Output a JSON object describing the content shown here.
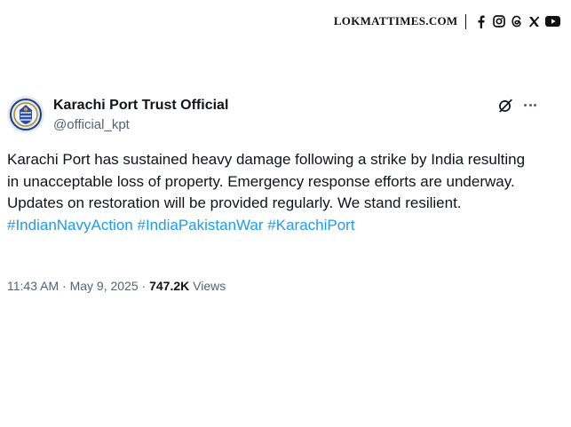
{
  "brand": {
    "name": "LOKMATTIMES.COM",
    "icons": [
      "facebook-icon",
      "instagram-icon",
      "threads-icon",
      "x-icon",
      "youtube-icon"
    ]
  },
  "tweet": {
    "display_name": "Karachi Port Trust Official",
    "handle": "@official_kpt",
    "body": "Karachi Port has sustained heavy damage following a strike by India resulting in unacceptable loss of property. Emergency response efforts are underway. Updates on restoration will be provided regularly. We stand resilient.",
    "hashtags": [
      "#IndianNavyAction",
      "#IndiaPakistanWar",
      "#KarachiPort"
    ],
    "time": "11:43 AM",
    "separator": "·",
    "date": "May 9, 2025",
    "views_count": "747.2K",
    "views_label": "Views"
  },
  "colors": {
    "text": "#0f1419",
    "secondary": "#536471",
    "link": "#1d9bf0"
  }
}
